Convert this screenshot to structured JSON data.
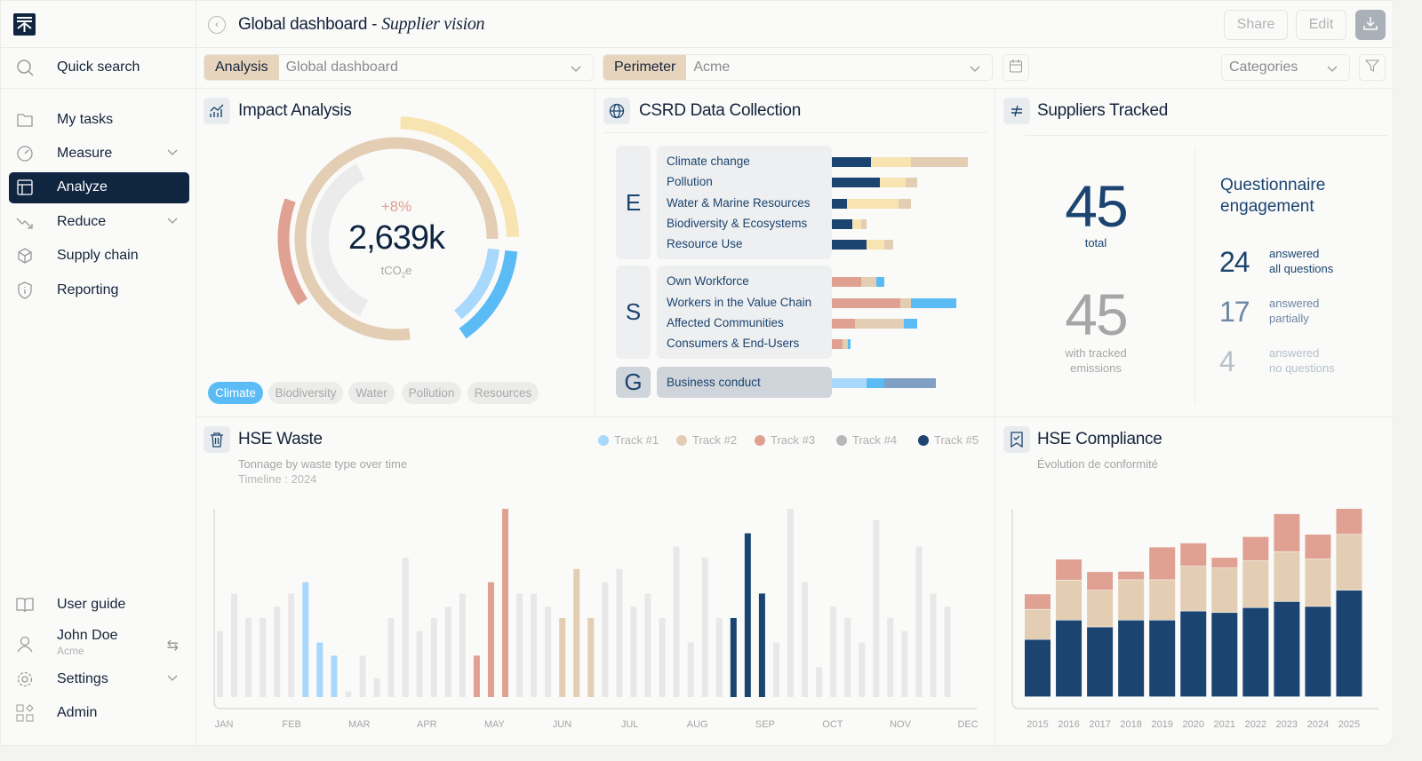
{
  "sidebar": {
    "quick_search": "Quick search",
    "items": [
      {
        "label": "My tasks",
        "icon": "folder-icon"
      },
      {
        "label": "Measure",
        "icon": "gauge-icon",
        "expandable": true
      },
      {
        "label": "Analyze",
        "icon": "layout-icon",
        "active": true
      },
      {
        "label": "Reduce",
        "icon": "trend-down-icon",
        "expandable": true
      },
      {
        "label": "Supply chain",
        "icon": "box-icon"
      },
      {
        "label": "Reporting",
        "icon": "shield-info-icon"
      }
    ],
    "user_guide": "User guide",
    "user": {
      "name": "John Doe",
      "org": "Acme"
    },
    "settings": "Settings",
    "admin": "Admin"
  },
  "header": {
    "title": "Global dashboard - ",
    "title_italic": "Supplier vision",
    "share": "Share",
    "edit": "Edit"
  },
  "filters": {
    "analysis_label": "Analysis",
    "analysis_value": "Global dashboard",
    "perimeter_label": "Perimeter",
    "perimeter_value": "Acme",
    "categories": "Categories"
  },
  "impact": {
    "title": "Impact Analysis",
    "change": "+8%",
    "value": "2,639k",
    "unit": "tCO",
    "unit_sub": "2",
    "unit_end": "e",
    "pills": [
      "Climate",
      "Biodiversity",
      "Water",
      "Pollution",
      "Resources"
    ],
    "active_pill": "Climate"
  },
  "csrd": {
    "title": "CSRD Data Collection",
    "groups": [
      {
        "letter": "E",
        "topics": [
          {
            "name": "Climate change",
            "values": [
              29,
              30,
              43
            ]
          },
          {
            "name": "Pollution",
            "values": [
              36,
              19,
              9
            ]
          },
          {
            "name": "Water & Marine Resources",
            "values": [
              11,
              39,
              9
            ]
          },
          {
            "name": "Biodiversity & Ecosystems",
            "values": [
              15,
              7,
              4
            ]
          },
          {
            "name": "Resource Use",
            "values": [
              26,
              13,
              7
            ]
          }
        ]
      },
      {
        "letter": "S",
        "topics": [
          {
            "name": "Own Workforce",
            "values": [
              22,
              11,
              6
            ]
          },
          {
            "name": "Workers in the Value Chain",
            "values": [
              51,
              8,
              34
            ]
          },
          {
            "name": "Affected Communities",
            "values": [
              17,
              37,
              10
            ]
          },
          {
            "name": "Consumers & End-Users",
            "values": [
              8,
              4,
              2
            ]
          }
        ]
      },
      {
        "letter": "G",
        "topics": [
          {
            "name": "Business conduct",
            "values": [
              26,
              13,
              39
            ]
          }
        ]
      }
    ],
    "colors": {
      "E": [
        "#1b4470",
        "#f8e4b0",
        "#e3cdb3"
      ],
      "S": [
        "#e0a192",
        "#e3cdb3",
        "#5bbcf5"
      ],
      "G": [
        "#a8d8fb",
        "#5bbcf5",
        "#7f9fc4"
      ]
    }
  },
  "suppliers": {
    "title": "Suppliers Tracked",
    "total": "45",
    "total_label": "total",
    "tracked": "45",
    "tracked_label_1": "with tracked",
    "tracked_label_2": "emissions",
    "q_title_1": "Questionnaire",
    "q_title_2": "engagement",
    "rows": [
      {
        "value": "24",
        "l1": "answered",
        "l2": "all questions"
      },
      {
        "value": "17",
        "l1": "answered",
        "l2": "partially"
      },
      {
        "value": "4",
        "l1": "answered",
        "l2": "no questions"
      }
    ]
  },
  "chart_data": [
    {
      "type": "bar",
      "title": "HSE Waste",
      "subtitle": "Tonnage by waste type over time",
      "timeline": "Timeline : 2024",
      "legend": [
        {
          "name": "Track #1",
          "color": "#a8d8fb"
        },
        {
          "name": "Track #2",
          "color": "#e3cdb3"
        },
        {
          "name": "Track #3",
          "color": "#e0a192"
        },
        {
          "name": "Track #4",
          "color": "#b8b8b8"
        },
        {
          "name": "Track #5",
          "color": "#1b4470"
        }
      ],
      "legend_position": "top-right",
      "months": [
        "JAN",
        "FEB",
        "MAR",
        "APR",
        "MAY",
        "JUN",
        "JUL",
        "AUG",
        "SEP",
        "OCT",
        "NOV",
        "DEC"
      ],
      "values": [
        35,
        55,
        42,
        42,
        48,
        55,
        61,
        29,
        22,
        3,
        22,
        10,
        42,
        74,
        35,
        42,
        48,
        55,
        22,
        61,
        100,
        55,
        55,
        48,
        42,
        68,
        42,
        61,
        68,
        48,
        55,
        42,
        80,
        29,
        74,
        42,
        42,
        87,
        55,
        29,
        100,
        61,
        16,
        48,
        42,
        29,
        94,
        42,
        35,
        80,
        55,
        48
      ],
      "highlight": {
        "6": 0,
        "7": 0,
        "8": 0,
        "18": 2,
        "19": 2,
        "20": 2,
        "24": 1,
        "25": 1,
        "26": 1,
        "36": 4,
        "37": 4,
        "38": 4
      },
      "ylim": [
        0,
        100
      ]
    },
    {
      "type": "bar",
      "stacked": true,
      "title": "HSE Compliance",
      "subtitle": "Évolution de conformité",
      "categories": [
        "2015",
        "2016",
        "2017",
        "2018",
        "2019",
        "2020",
        "2021",
        "2022",
        "2023",
        "2024",
        "2025"
      ],
      "series": [
        {
          "name": "base",
          "color": "#1b4470",
          "values": [
            19.8,
            26.5,
            24.1,
            26.5,
            26.5,
            29.6,
            29.1,
            30.8,
            32.9,
            31.2,
            36.8
          ]
        },
        {
          "name": "mid",
          "color": "#e3cdb3",
          "values": [
            10.4,
            13.8,
            12.7,
            13.9,
            13.9,
            15.5,
            15.4,
            16.2,
            17.2,
            16.4,
            19.3
          ]
        },
        {
          "name": "top",
          "color": "#e0a192",
          "values": [
            5.3,
            7.2,
            6.4,
            2.9,
            11.3,
            8.0,
            3.6,
            8.3,
            13.1,
            8.5,
            8.9
          ]
        }
      ],
      "ylim": [
        0,
        65
      ]
    }
  ]
}
